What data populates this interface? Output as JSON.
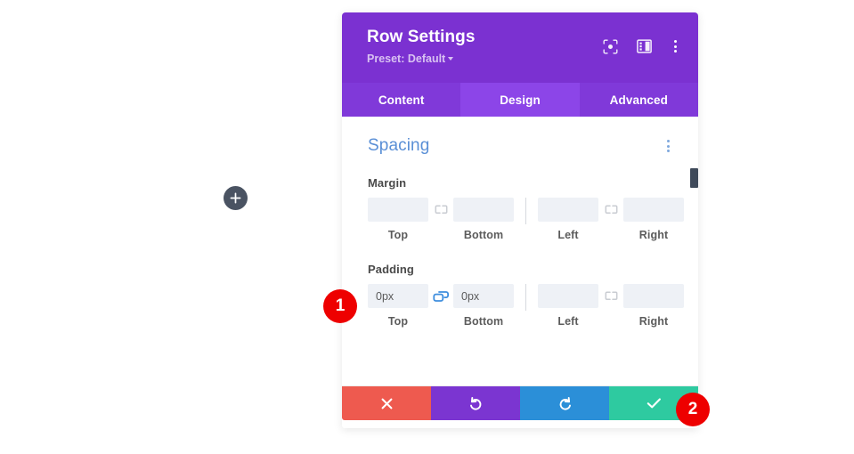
{
  "canvas": {
    "add_button": {
      "icon": "plus-icon",
      "label": ""
    }
  },
  "modal": {
    "title": "Row Settings",
    "preset": "Preset: Default",
    "header_icons": [
      {
        "name": "focus-target-icon",
        "label": ""
      },
      {
        "name": "layout-panel-icon",
        "label": ""
      },
      {
        "name": "more-options-icon",
        "label": ""
      }
    ],
    "tabs": [
      {
        "label": "Content",
        "active": false
      },
      {
        "label": "Design",
        "active": true
      },
      {
        "label": "Advanced",
        "active": false
      }
    ],
    "section": {
      "title": "Spacing",
      "options_icon": "section-options-icon"
    },
    "groups": [
      {
        "label": "Margin",
        "pairs": [
          {
            "linked": false,
            "link_icon": "broken-link-icon",
            "fields": [
              {
                "caption": "Top",
                "value": "",
                "placeholder": ""
              },
              {
                "caption": "Bottom",
                "value": "",
                "placeholder": ""
              }
            ]
          },
          {
            "linked": false,
            "link_icon": "broken-link-icon",
            "fields": [
              {
                "caption": "Left",
                "value": "",
                "placeholder": ""
              },
              {
                "caption": "Right",
                "value": "",
                "placeholder": ""
              }
            ]
          }
        ]
      },
      {
        "label": "Padding",
        "pairs": [
          {
            "linked": true,
            "link_icon": "linked-chain-icon",
            "fields": [
              {
                "caption": "Top",
                "value": "0px",
                "placeholder": ""
              },
              {
                "caption": "Bottom",
                "value": "0px",
                "placeholder": ""
              }
            ]
          },
          {
            "linked": false,
            "link_icon": "broken-link-icon",
            "fields": [
              {
                "caption": "Left",
                "value": "",
                "placeholder": ""
              },
              {
                "caption": "Right",
                "value": "",
                "placeholder": ""
              }
            ]
          }
        ]
      }
    ],
    "footer": [
      {
        "name": "cancel-button",
        "icon": "close-x-icon",
        "label": "",
        "color": "#ee5a4f"
      },
      {
        "name": "undo-button",
        "icon": "undo-arrow-icon",
        "label": "",
        "color": "#7b35d1"
      },
      {
        "name": "redo-button",
        "icon": "redo-arrow-icon",
        "label": "",
        "color": "#2b8fd8"
      },
      {
        "name": "save-button",
        "icon": "checkmark-icon",
        "label": "",
        "color": "#2ecaa0"
      }
    ]
  },
  "annotations": [
    {
      "number": "1",
      "color": "#ee0000"
    },
    {
      "number": "2",
      "color": "#ee0000"
    }
  ],
  "colors": {
    "header_purple": "#7b31d1",
    "tab_bar_purple": "#8039d9",
    "tab_active_purple": "#8c45e8",
    "section_title_blue": "#5a8fd6",
    "input_bg": "#eef1f6",
    "link_active_blue": "#3f8ede",
    "link_inactive_gray": "#c9ccd2",
    "badge_red": "#ee0000"
  }
}
